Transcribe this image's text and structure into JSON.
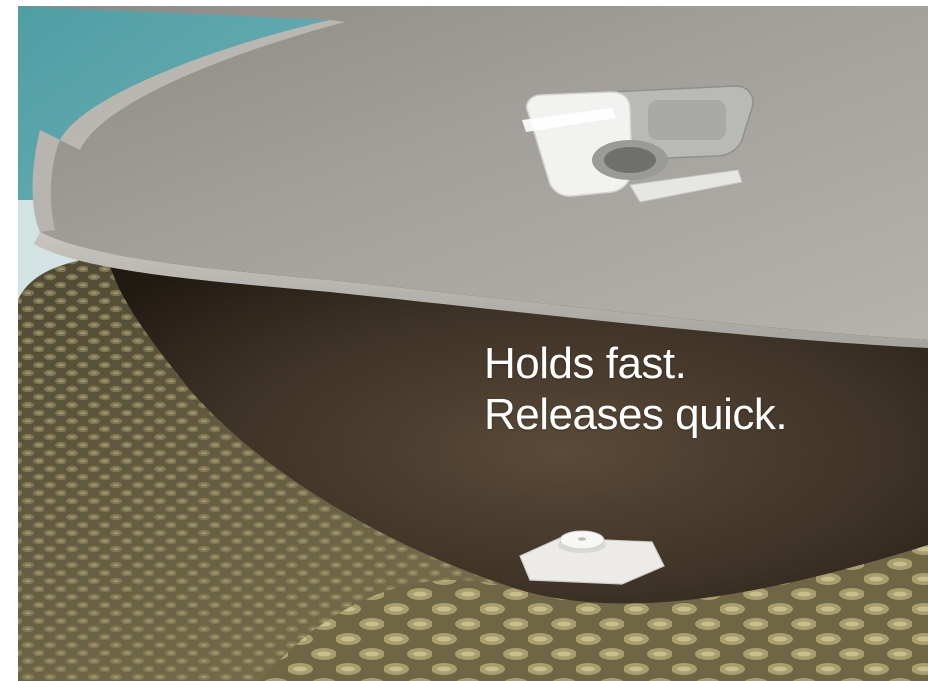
{
  "headline": {
    "line1": "Holds fast.",
    "line2": "Releases quick."
  },
  "colors": {
    "pool_water": "#5aa7ad",
    "cushion_fabric": "#9d9a95",
    "cushion_edge": "#c9c6c1",
    "platform_fabric": "#3d3226",
    "wicker": "#6b6446",
    "clip_white": "#f2f2f0",
    "text": "#ffffff"
  },
  "icons": {
    "upper_clip": "quick-release-clip-icon",
    "lower_clip": "snap-button-base-icon"
  }
}
